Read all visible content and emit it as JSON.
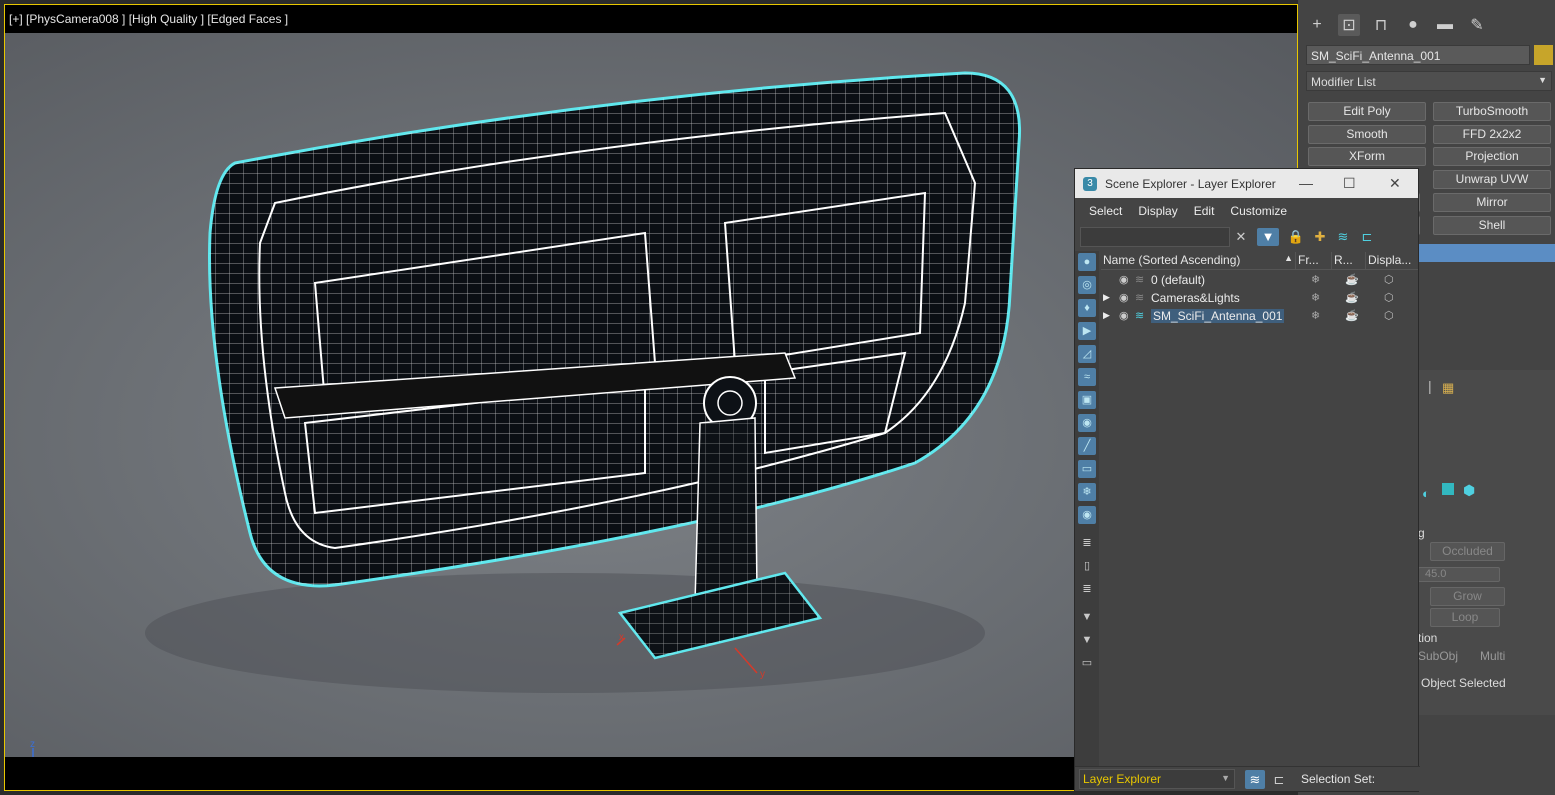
{
  "viewport": {
    "label": "[+] [PhysCamera008 ] [High Quality ] [Edged Faces ]",
    "axis_z": "z",
    "axis_x": "x",
    "gizmo_x": "x",
    "gizmo_y": "y"
  },
  "command_panel": {
    "tabs": [
      {
        "icon": "create-icon",
        "glyph": "+"
      },
      {
        "icon": "modify-icon",
        "glyph": "⊡"
      },
      {
        "icon": "hierarchy-icon",
        "glyph": "⊓"
      },
      {
        "icon": "motion-icon",
        "glyph": "●"
      },
      {
        "icon": "display-icon",
        "glyph": "▬"
      },
      {
        "icon": "utilities-icon",
        "glyph": "✎"
      }
    ],
    "object_name": "SM_SciFi_Antenna_001",
    "object_color": "#c7a52a",
    "modifier_list_label": "Modifier List",
    "modifier_buttons": [
      "Edit Poly",
      "TurboSmooth",
      "Smooth",
      "FFD 2x2x2",
      "XForm",
      "Projection",
      "",
      "Unwrap UVW",
      "",
      "Mirror",
      "",
      "Shell"
    ],
    "lower": {
      "occluded": "Occluded",
      "angle": "45.0",
      "grow": "Grow",
      "loop": "Loop",
      "section": "tion",
      "subobj": "SubObj",
      "multi": "Multi",
      "object_selected": "Object Selected",
      "label_g": "g"
    }
  },
  "scene_explorer": {
    "title": "Scene Explorer - Layer Explorer",
    "menu": [
      "Select",
      "Display",
      "Edit",
      "Customize"
    ],
    "columns": [
      "Name (Sorted Ascending)",
      "Fr...",
      "R...",
      "Displa..."
    ],
    "rows": [
      {
        "name": "0 (default)",
        "expandable": false,
        "selected": false
      },
      {
        "name": "Cameras&Lights",
        "expandable": true,
        "selected": false
      },
      {
        "name": "SM_SciFi_Antenna_001",
        "expandable": true,
        "selected": true
      }
    ],
    "footer": {
      "explorer_dropdown": "Layer Explorer",
      "selection_set_label": "Selection Set:"
    }
  },
  "colors": {
    "viewport_border": "#e8c700",
    "wire_highlight": "#5fe8ee",
    "selection_blue": "#5b8dc4"
  }
}
